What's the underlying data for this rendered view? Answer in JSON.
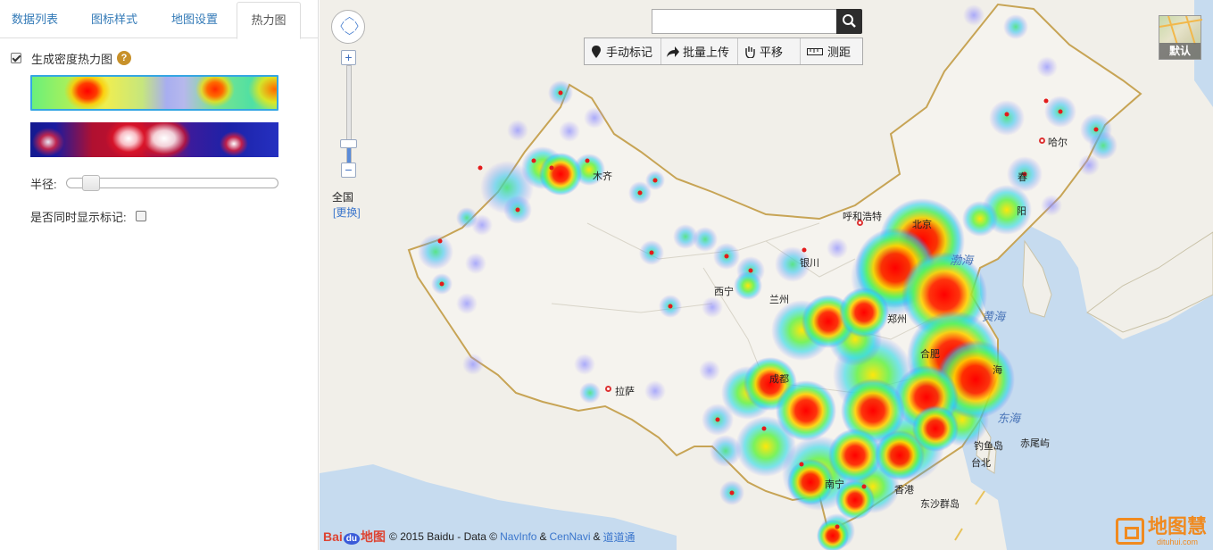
{
  "tabs": [
    {
      "label": "数据列表"
    },
    {
      "label": "图标样式"
    },
    {
      "label": "地图设置"
    },
    {
      "label": "热力图"
    }
  ],
  "heatmap_panel": {
    "enable_label": "生成密度热力图",
    "enable_checked": true,
    "help_symbol": "?",
    "radius_label": "半径:",
    "radius_value": 0.1,
    "show_markers_label": "是否同时显示标记:",
    "show_markers_checked": false
  },
  "map": {
    "search_placeholder": "",
    "tools": [
      {
        "icon": "pin-icon",
        "label": "手动标记"
      },
      {
        "icon": "share-arrow-icon",
        "label": "批量上传"
      },
      {
        "icon": "hand-icon",
        "label": "平移"
      },
      {
        "icon": "ruler-icon",
        "label": "测距"
      }
    ],
    "zoom_level_label": "全国",
    "zoom_change_label": "[更换]",
    "zoom_plus": "+",
    "zoom_minus": "−",
    "maptype_label": "默认",
    "copyright_prefix": "© 2015 Baidu - Data ©",
    "copyright_links": [
      "NavInfo",
      "CenNavi",
      "道道通"
    ],
    "copyright_amp": "&",
    "baidu_logo_text": {
      "bai": "Bai",
      "du": "du",
      "map": "地图"
    },
    "watermark": {
      "title": "地图慧",
      "subtitle": "dituhui.com"
    },
    "city_labels": {
      "wulumuqi": "木齐",
      "haerbin": "哈尔",
      "huhehaote": "呼和浩特",
      "beijing": "北京",
      "yinchuan": "银川",
      "xining": "西宁",
      "lanzhou": "兰州",
      "zhengzhou": "郑州",
      "lasa": "拉萨",
      "shanghai": "海",
      "hefei": "合肥",
      "chengdu": "成都",
      "nanning": "南宁",
      "hongkong": "香港",
      "taibei": "台北",
      "diaoyudao": "钓鱼岛",
      "chiweiyu": "赤尾屿",
      "dongsha": "东沙群岛",
      "shenyang": "阳",
      "changchun": "春"
    },
    "sea_labels": {
      "bohai": "渤海",
      "huanghai": "黄海",
      "donghai": "东海"
    }
  }
}
